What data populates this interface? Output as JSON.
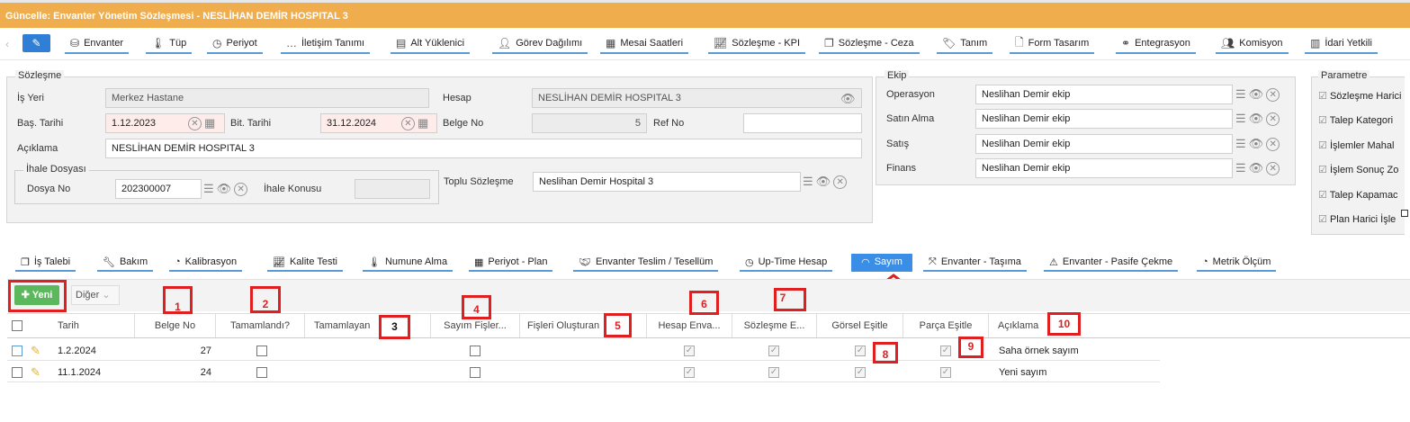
{
  "window": {
    "title": "Güncelle: Envanter Yönetim Sözleşmesi - NESLİHAN DEMİR HOSPITAL 3"
  },
  "toolbar1": [
    {
      "label": "Envanter",
      "icon": "cubes-icon"
    },
    {
      "label": "Tüp",
      "icon": "thermometer-icon"
    },
    {
      "label": "Periyot",
      "icon": "clock-icon"
    },
    {
      "label": "İletişim Tanımı",
      "icon": "chat-icon"
    },
    {
      "label": "Alt Yüklenici",
      "icon": "building-icon"
    },
    {
      "label": "Görev Dağılımı",
      "icon": "user-icon"
    },
    {
      "label": "Mesai Saatleri",
      "icon": "calendar-icon"
    },
    {
      "label": "Sözleşme - KPI",
      "icon": "line-chart-icon"
    },
    {
      "label": "Sözleşme - Ceza",
      "icon": "copy-icon"
    },
    {
      "label": "Tanım",
      "icon": "tags-icon"
    },
    {
      "label": "Form Tasarım",
      "icon": "file-icon"
    },
    {
      "label": "Entegrasyon",
      "icon": "link-icon"
    },
    {
      "label": "Komisyon",
      "icon": "users-icon"
    },
    {
      "label": "İdari Yetkili",
      "icon": "id-card-icon"
    }
  ],
  "contract": {
    "legend": "Sözleşme",
    "is_yeri_label": "İş Yeri",
    "is_yeri": "Merkez Hastane",
    "hesap_label": "Hesap",
    "hesap": "NESLİHAN DEMİR HOSPITAL 3",
    "bas_tarihi_label": "Baş. Tarihi",
    "bas_tarihi": "1.12.2023",
    "bit_tarihi_label": "Bit. Tarihi",
    "bit_tarihi": "31.12.2024",
    "belge_no_label": "Belge No",
    "belge_no": "5",
    "ref_no_label": "Ref No",
    "ref_no": "",
    "aciklama_label": "Açıklama",
    "aciklama": "NESLİHAN DEMİR HOSPITAL 3",
    "ihale_legend": "İhale Dosyası",
    "dosya_no_label": "Dosya No",
    "dosya_no": "202300007",
    "ihale_konusu_label": "İhale Konusu",
    "ihale_konusu": "",
    "toplu_label": "Toplu Sözleşme",
    "toplu": "Neslihan Demir Hospital 3"
  },
  "ekip": {
    "legend": "Ekip",
    "rows": [
      {
        "label": "Operasyon",
        "value": "Neslihan Demir ekip"
      },
      {
        "label": "Satın Alma",
        "value": "Neslihan Demir ekip"
      },
      {
        "label": "Satış",
        "value": "Neslihan Demir ekip"
      },
      {
        "label": "Finans",
        "value": "Neslihan Demir ekip"
      }
    ]
  },
  "parametre": {
    "legend": "Parametre",
    "items": [
      "Sözleşme Harici",
      "Talep Kategori",
      "İşlemler Mahal",
      "İşlem Sonuç Zo",
      "Talep Kapamac",
      "Plan Harici İşle"
    ]
  },
  "toolbar2": [
    {
      "label": "İş Talebi",
      "icon": "copy-icon"
    },
    {
      "label": "Bakım",
      "icon": "wrench-icon"
    },
    {
      "label": "Kalibrasyon",
      "icon": "gauge-icon"
    },
    {
      "label": "Kalite Testi",
      "icon": "line-chart-icon"
    },
    {
      "label": "Numune Alma",
      "icon": "thermometer-icon"
    },
    {
      "label": "Periyot - Plan",
      "icon": "calendar-check-icon"
    },
    {
      "label": "Envanter Teslim / Tesellüm",
      "icon": "handshake-icon"
    },
    {
      "label": "Up-Time Hesap",
      "icon": "clock-icon"
    },
    {
      "label": "Sayım",
      "icon": "wifi-icon"
    },
    {
      "label": "Envanter - Taşıma",
      "icon": "arrows-icon"
    },
    {
      "label": "Envanter - Pasife Çekme",
      "icon": "warning-icon"
    },
    {
      "label": "Metrik Ölçüm",
      "icon": "gauge-icon"
    }
  ],
  "actions": {
    "yeni": "Yeni",
    "diger": "Diğer"
  },
  "table": {
    "headers": [
      "Tarih",
      "Belge No",
      "Tamamlandı?",
      "Tamamlayan",
      "Sayım Fişler...",
      "Fişleri Oluşturan",
      "Hesap Enva...",
      "Sözleşme E...",
      "Görsel Eşitle",
      "Parça Eşitle",
      "Açıklama"
    ],
    "rows": [
      {
        "tarih": "1.2.2024",
        "belge_no": "27",
        "aciklama": "Saha örnek sayım"
      },
      {
        "tarih": "11.1.2024",
        "belge_no": "24",
        "aciklama": "Yeni sayım"
      }
    ]
  },
  "annotations": [
    "1",
    "2",
    "3",
    "4",
    "5",
    "6",
    "7",
    "8",
    "9",
    "10"
  ],
  "colors": {
    "title_bar": "#f0ad4e",
    "accent": "#3a8ee6",
    "annotation": "#e02020",
    "new_button": "#5cb85c"
  }
}
